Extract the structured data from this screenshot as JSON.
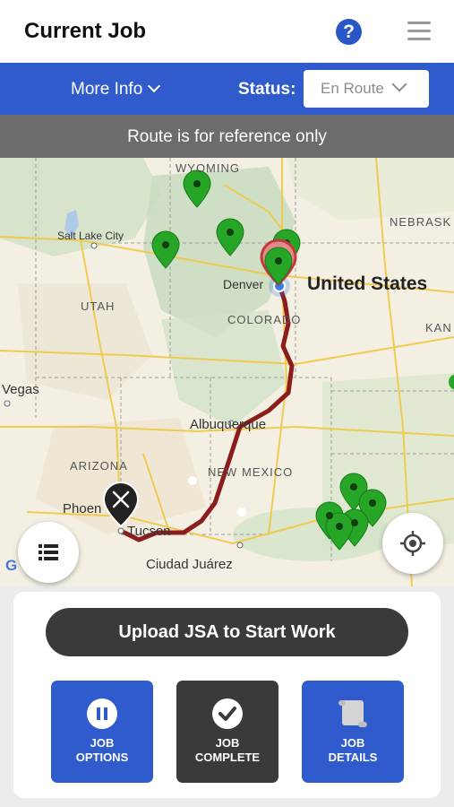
{
  "header": {
    "title": "Current Job",
    "help_icon": "?"
  },
  "info_bar": {
    "more_info_label": "More Info",
    "status_label": "Status:",
    "status_value": "En Route"
  },
  "banner": {
    "text": "Route is for reference only"
  },
  "map": {
    "labels": {
      "wyoming": "WYOMING",
      "nebraska": "NEBRASK",
      "salt_lake_city": "Salt Lake City",
      "denver": "Denver",
      "united_states": "United States",
      "utah": "UTAH",
      "colorado": "COLORADO",
      "kansas": "KAN",
      "las_vegas": "Vegas",
      "albuquerque": "Albuquerque",
      "arizona": "ARIZONA",
      "new_mexico": "NEW MEXICO",
      "phoenix": "Phoen",
      "tucson": "Tucson",
      "ciudad_juarez": "Ciudad Juárez",
      "google": "G"
    },
    "colors": {
      "route": "#8b1d1d",
      "pin": "#26a526",
      "origin": "#3a7bef"
    }
  },
  "bottom": {
    "upload_label": "Upload JSA to Start Work",
    "tiles": [
      {
        "line1": "JOB",
        "line2": "OPTIONS",
        "icon": "pause-icon"
      },
      {
        "line1": "JOB",
        "line2": "COMPLETE",
        "icon": "check-icon"
      },
      {
        "line1": "JOB",
        "line2": "DETAILS",
        "icon": "scroll-icon"
      }
    ]
  }
}
